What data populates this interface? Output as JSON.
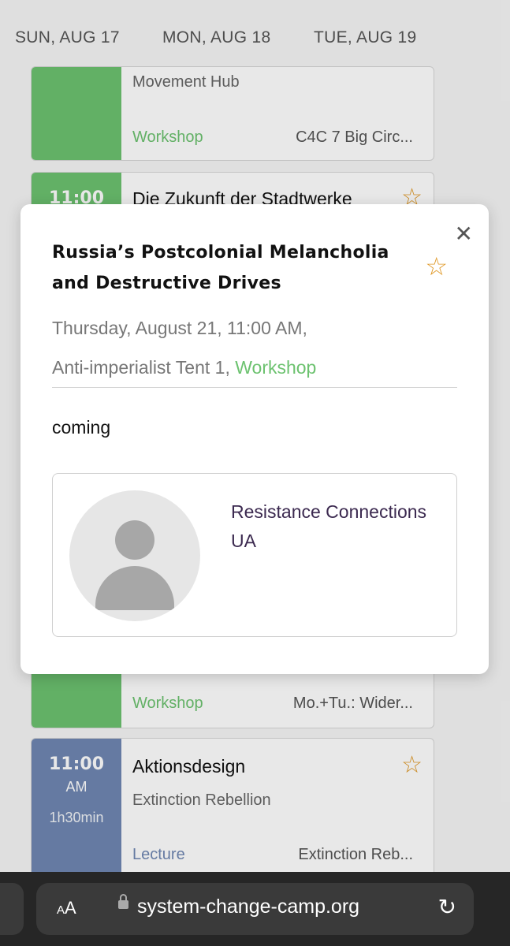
{
  "days": [
    "SUN, AUG 17",
    "MON, AUG 18",
    "TUE, AUG 19"
  ],
  "cards": [
    {
      "title": "",
      "organizer": "Movement Hub",
      "type": "Workshop",
      "room": "C4C 7 Big Circ...",
      "color": "#6cc26f"
    },
    {
      "time": "11:00",
      "title": "Die Zukunft der Stadtwerke",
      "color": "#6cc26f"
    },
    {
      "type": "Workshop",
      "room": "Mo.+Tu.: Wider...",
      "color": "#6cc26f"
    },
    {
      "time": "11:00",
      "ampm": "AM",
      "duration": "1h30min",
      "title": "Aktionsdesign",
      "organizer": "Extinction Rebellion",
      "type": "Lecture",
      "room": "Extinction Reb...",
      "color": "#6f87b3"
    }
  ],
  "modal": {
    "title": "Russia’s Postcolonial Melancholia and Destructive Drives",
    "datetime": "Thursday, August 21, 11:00  AM,",
    "location": "Anti-imperialist Tent 1,",
    "type": "Workshop",
    "description": "coming",
    "speaker": "Resistance Connections UA",
    "close_icon": "close-icon",
    "star_icon": "star-outline-icon"
  },
  "browser": {
    "text_size_label_small": "A",
    "text_size_label_large": "A",
    "url": "system-change-camp.org"
  }
}
